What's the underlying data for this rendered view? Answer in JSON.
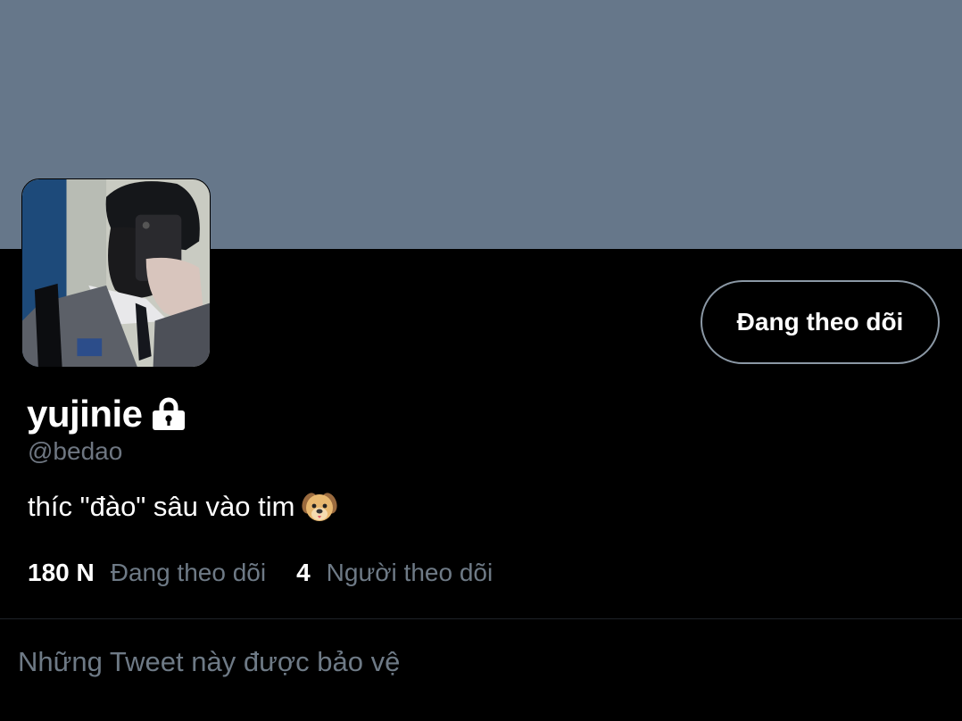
{
  "profile": {
    "display_name": "yujinie",
    "handle": "@bedao",
    "bio": "thíc \"đào\" sâu vào tim",
    "bio_emoji": "dog-face-emoji",
    "locked_icon": "lock-icon"
  },
  "actions": {
    "follow_button_label": "Đang theo dõi"
  },
  "stats": {
    "following_count": "180 N",
    "following_label": "Đang theo dõi",
    "followers_count": "4",
    "followers_label": "Người theo dõi"
  },
  "tweets": {
    "protected_message": "Những Tweet này được bảo vệ"
  },
  "colors": {
    "banner": "#66778a",
    "background": "#000000",
    "secondary_text": "#6e7a86",
    "button_border": "#8b98a5"
  }
}
